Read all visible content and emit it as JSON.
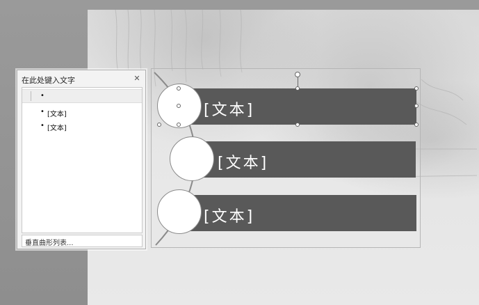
{
  "text_pane": {
    "title": "在此处键入文字",
    "close_glyph": "✕",
    "items": [
      {
        "bullet": "•",
        "text": ""
      },
      {
        "bullet": "•",
        "text": "[文本]"
      },
      {
        "bullet": "•",
        "text": "[文本]"
      }
    ],
    "footer_link": "垂直曲形列表..."
  },
  "smartart": {
    "items": [
      {
        "text": "[文本]"
      },
      {
        "text": "[文本]"
      },
      {
        "text": "[文本]"
      }
    ],
    "colors": {
      "bar": "#595959",
      "circle_fill": "#ffffff",
      "curve": "#8a8a8a"
    }
  }
}
